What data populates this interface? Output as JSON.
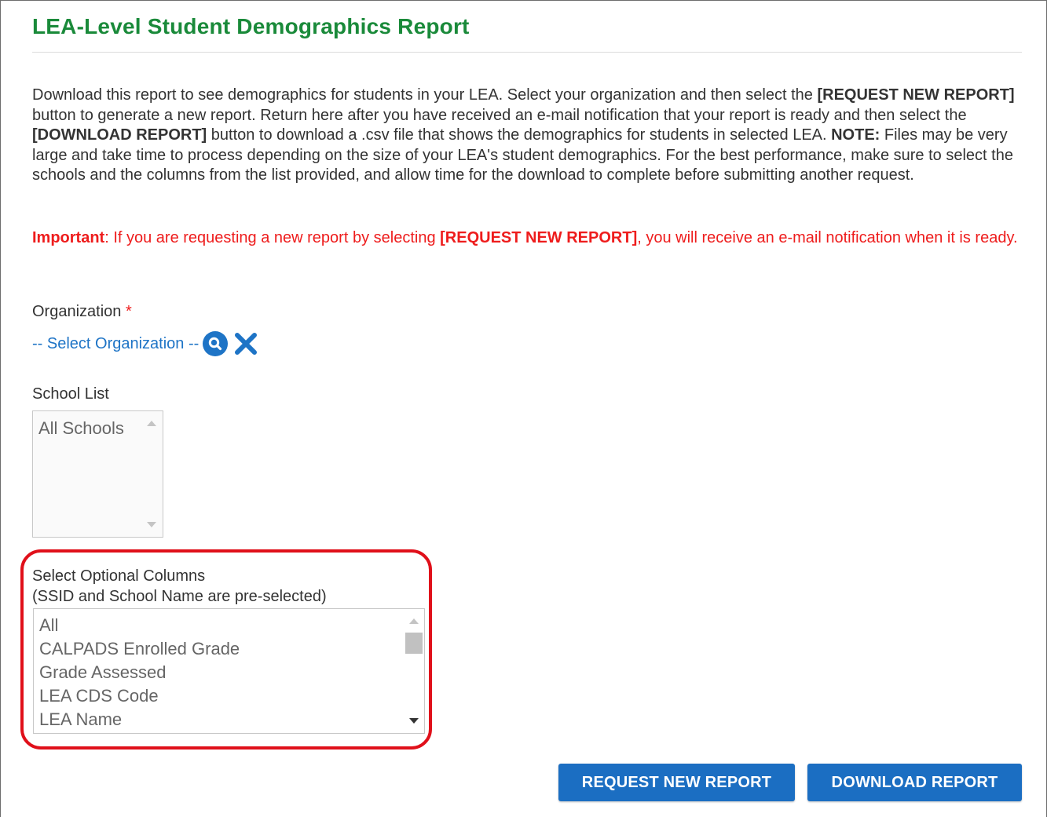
{
  "page": {
    "title": "LEA-Level Student Demographics Report"
  },
  "description": {
    "p1": "Download this report to see demographics for students in your LEA. Select your organization and then select the ",
    "b1": "[REQUEST NEW REPORT]",
    "p2": " button to generate a new report. Return here after you have received an e-mail notification that your report is ready and then select the ",
    "b2": "[DOWNLOAD REPORT]",
    "p3": " button to download a .csv file that shows the demographics for students in selected LEA. ",
    "b3": "NOTE:",
    "p4": " Files may be very large and take time to process depending on the size of your LEA's student demographics. For the best performance, make sure to select the schools and the columns from the list provided, and allow time for the download to complete before submitting another request."
  },
  "important": {
    "b1": "Important",
    "p1": ": If you are requesting a new report by selecting ",
    "b2": "[REQUEST NEW REPORT]",
    "p2": ", you will receive an e-mail notification when it is ready."
  },
  "organization": {
    "label": "Organization",
    "required_marker": "*",
    "select_text": "-- Select Organization --"
  },
  "school_list": {
    "label": "School List",
    "items": [
      "All Schools"
    ]
  },
  "optional_columns": {
    "label_line1": "Select Optional Columns",
    "label_line2": "(SSID and School Name are pre-selected)",
    "items": [
      "All",
      "CALPADS Enrolled Grade",
      "Grade Assessed",
      "LEA CDS Code",
      "LEA Name"
    ]
  },
  "buttons": {
    "request": "REQUEST NEW REPORT",
    "download": "DOWNLOAD REPORT"
  },
  "colors": {
    "title_green": "#1a8a3a",
    "important_red": "#ee1c1c",
    "link_blue": "#1e74c6",
    "button_blue": "#1b6ec2",
    "highlight_red": "#e0101a"
  },
  "icons": {
    "search": "search-icon",
    "clear": "close-icon"
  }
}
